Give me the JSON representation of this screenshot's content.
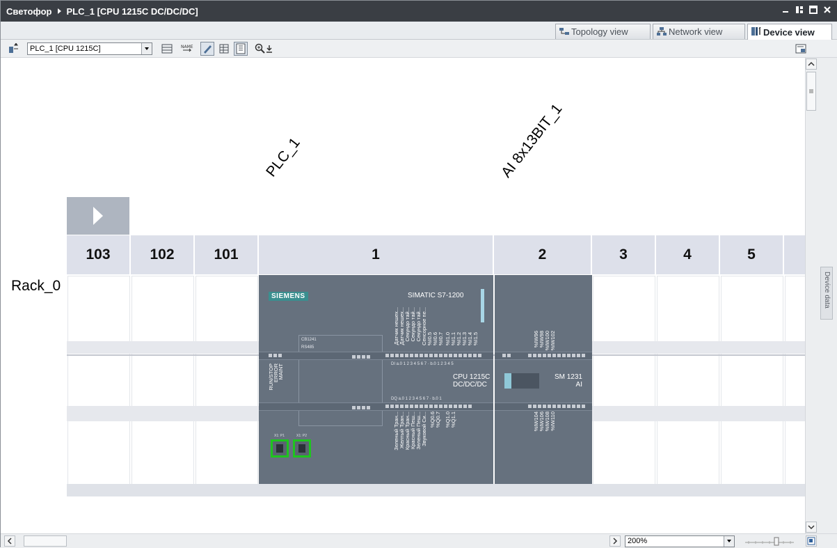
{
  "window": {
    "project": "Светофор",
    "device": "PLC_1 [CPU 1215C DC/DC/DC]"
  },
  "view_tabs": [
    {
      "label": "Topology view",
      "icon": "topology-icon"
    },
    {
      "label": "Network view",
      "icon": "network-icon"
    },
    {
      "label": "Device view",
      "icon": "device-icon",
      "active": true
    }
  ],
  "toolbar": {
    "device_select": "PLC_1 [CPU 1215C]"
  },
  "canvas": {
    "plc_name": "PLC_1",
    "module_name": "AI 8x13BIT_1",
    "rack_label": "Rack_0",
    "slots": [
      "103",
      "102",
      "101",
      "1",
      "2",
      "3",
      "4",
      "5"
    ]
  },
  "cpu": {
    "brand": "SIEMENS",
    "family": "SIMATIC S7-1200",
    "model_line1": "CPU 1215C",
    "model_line2": "DC/DC/DC",
    "board_line1": "CB1241",
    "board_line2": "RS485",
    "status_leds": [
      "RUN/STOP",
      "ERROR",
      "MAINT"
    ],
    "inputs_top": [
      "Датчик нешех...",
      "Датчик нешех...",
      "Секундо тай...",
      "Секундо тай...",
      "Секундо тай...",
      "Сенсорное пе..."
    ],
    "addr_top": [
      "%I0.5",
      "%I0.6",
      "%I0.7",
      "%I1.0",
      "%I1.1",
      "%I1.2",
      "%I1.3",
      "%I1.4",
      "%I1.5"
    ],
    "outputs_bottom": [
      "Зеленый Тран...",
      "Желтый Тран...",
      "Красный Тран...",
      "Красный Пеш...",
      "Зеленый Пеш...",
      "Звуковой Си..."
    ],
    "addr_bottom": [
      "%Q0.6",
      "%Q0.7",
      "%Q1.0",
      "%Q1.1"
    ],
    "port1": "X1: P1",
    "port2": "X1: P2"
  },
  "sm": {
    "model_line1": "SM 1231",
    "model_line2": "AI",
    "addr_top": [
      "%IW96",
      "%IW98",
      "%IW100",
      "%IW102"
    ],
    "addr_bottom": [
      "%IW104",
      "%IW106",
      "%IW108",
      "%IW110"
    ]
  },
  "side_panel": {
    "label": "Device data"
  },
  "zoom": {
    "value": "200%"
  }
}
